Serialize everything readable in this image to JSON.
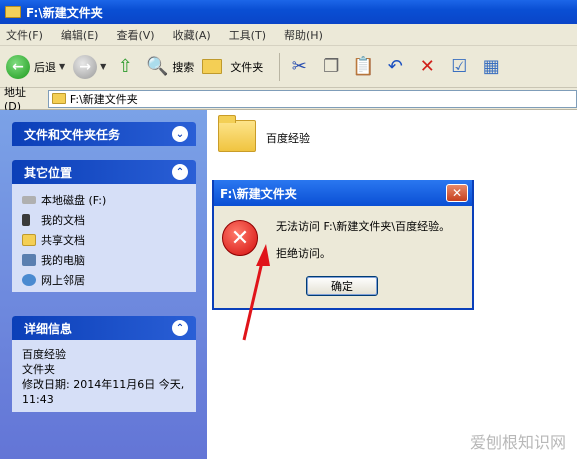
{
  "window": {
    "title": "F:\\新建文件夹"
  },
  "menu": [
    "文件(F)",
    "编辑(E)",
    "查看(V)",
    "收藏(A)",
    "工具(T)",
    "帮助(H)"
  ],
  "toolbar": {
    "back": "后退",
    "search": "搜索",
    "folders": "文件夹"
  },
  "address": {
    "label": "地址(D)",
    "value": "F:\\新建文件夹"
  },
  "tasks_panel": {
    "title": "文件和文件夹任务"
  },
  "places_panel": {
    "title": "其它位置",
    "items": [
      "本地磁盘 (F:)",
      "我的文档",
      "共享文档",
      "我的电脑",
      "网上邻居"
    ]
  },
  "details_panel": {
    "title": "详细信息",
    "name": "百度经验",
    "type": "文件夹",
    "modified": "修改日期: 2014年11月6日 今天, 11:43"
  },
  "content": {
    "folder_name": "百度经验"
  },
  "dialog": {
    "title": "F:\\新建文件夹",
    "message": "无法访问 F:\\新建文件夹\\百度经验。",
    "detail": "拒绝访问。",
    "ok": "确定"
  },
  "watermark": "爱刨根知识网"
}
